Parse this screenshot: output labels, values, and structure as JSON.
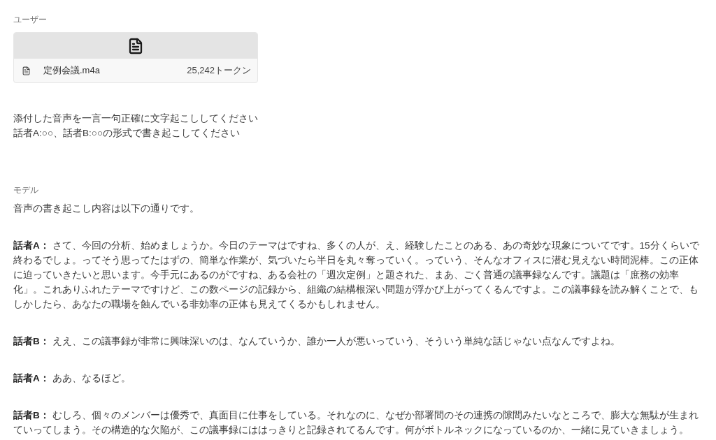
{
  "user_message": {
    "label": "ユーザー",
    "attachment": {
      "file_name": "定例会議.m4a",
      "token_count": "25,242トークン"
    },
    "text_lines": [
      "添付した音声を一言一句正確に文字起こししてください",
      "話者A:○○、話者B:○○の形式で書き起こしてください"
    ]
  },
  "model_message": {
    "label": "モデル",
    "paragraphs": [
      "音声の書き起こし内容は以下の通りです。",
      "**話者A：** さて、今回の分析、始めましょうか。今日のテーマはですね、多くの人が、え、経験したことのある、あの奇妙な現象についてです。15分くらいで終わるでしょ。ってそう思ってたはずの、簡単な作業が、気づいたら半日を丸々奪っていく。っていう、そんなオフィスに潜む見えない時間泥棒。この正体に迫っていきたいと思います。今手元にあるのがですね、ある会社の「週次定例」と題された、まあ、ごく普通の議事録なんです。議題は「庶務の効率化」。これありふれたテーマですけど、この数ページの記録から、組織の結構根深い問題が浮かび上がってくるんですよ。この議事録を読み解くことで、もしかしたら、あなたの職場を蝕んでいる非効率の正体も見えてくるかもしれません。",
      "**話者B：** ええ、この議事録が非常に興味深いのは、なんていうか、誰か一人が悪いっていう、そういう単純な話じゃない点なんですよね。",
      "**話者A：** ああ、なるほど。",
      "**話者B：** むしろ、個々のメンバーは優秀で、真面目に仕事をしている。それなのに、なぜか部署間のその連携の隙間みたいなところで、膨大な無駄が生まれていってしまう。その構造的な欠陥が、この議事録にははっきりと記録されてるんです。何がボトルネックになっているのか、一緒に見ていきましょう。"
    ]
  }
}
